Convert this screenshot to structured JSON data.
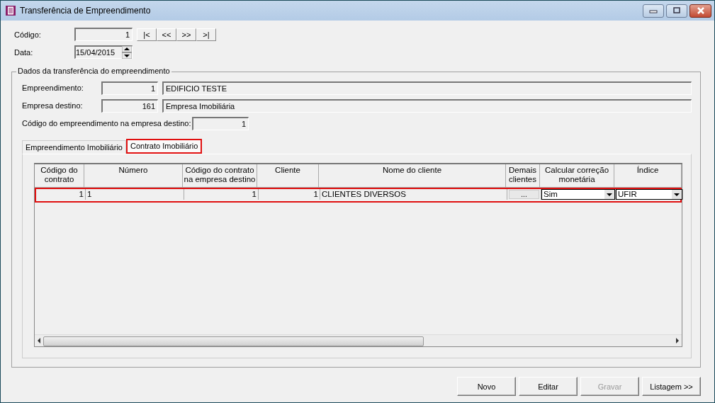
{
  "window": {
    "title": "Transferência de Empreendimento"
  },
  "codigo": {
    "label": "Código:",
    "value": "1"
  },
  "nav_buttons": [
    "|<",
    "<<",
    ">>",
    ">|"
  ],
  "data": {
    "label": "Data:",
    "value": "15/04/2015"
  },
  "group": {
    "legend": "Dados da transferência do empreendimento",
    "empreendimento": {
      "label": "Empreendimento:",
      "code": "1",
      "name": "EDIFICIO TESTE"
    },
    "empresa_destino": {
      "label": "Empresa destino:",
      "code": "161",
      "name": "Empresa Imobiliária"
    },
    "codigo_destino": {
      "label": "Código do empreendimento na empresa destino:",
      "value": "1"
    }
  },
  "tabs": [
    {
      "label": "Empreendimento Imobiliário",
      "selected": false
    },
    {
      "label": "Contrato Imobiliário",
      "selected": true
    }
  ],
  "table": {
    "columns": [
      {
        "label": "Código do contrato"
      },
      {
        "label": "Número"
      },
      {
        "label": "Código do contrato na empresa destino"
      },
      {
        "label": "Cliente"
      },
      {
        "label": "Nome do cliente"
      },
      {
        "label": "Demais clientes"
      },
      {
        "label": "Calcular correção monetária"
      },
      {
        "label": "Índice"
      }
    ],
    "rows": [
      {
        "selected": true,
        "cells": [
          {
            "kind": "text",
            "value": "1"
          },
          {
            "kind": "text",
            "value": "1"
          },
          {
            "kind": "text",
            "value": "1"
          },
          {
            "kind": "text",
            "value": "1"
          },
          {
            "kind": "text",
            "value": "CLIENTES DIVERSOS"
          },
          {
            "kind": "button",
            "value": "..."
          },
          {
            "kind": "dropdown",
            "value": "Sim"
          },
          {
            "kind": "dropdown",
            "value": "UFIR"
          }
        ]
      }
    ]
  },
  "buttons": [
    {
      "label": "Novo",
      "disabled": false
    },
    {
      "label": "Editar",
      "disabled": false
    },
    {
      "label": "Gravar",
      "disabled": true
    },
    {
      "label": "Listagem >>",
      "disabled": false
    }
  ]
}
